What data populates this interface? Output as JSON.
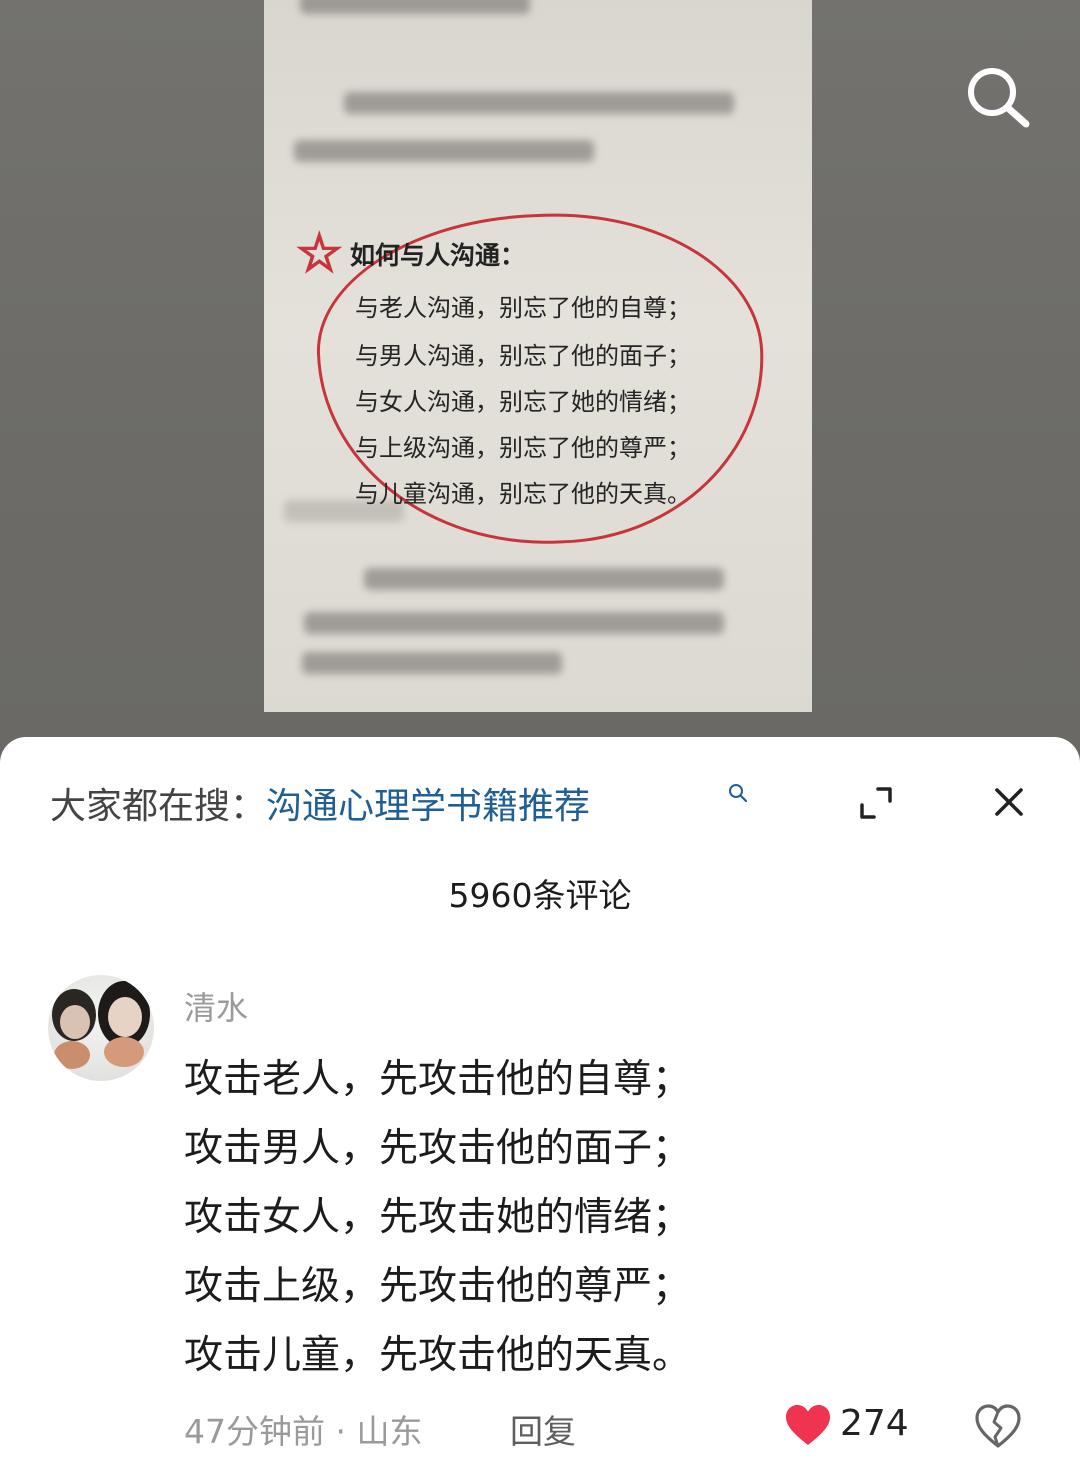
{
  "video": {
    "book": {
      "heading": "如何与人沟通：",
      "lines": [
        "与老人沟通，别忘了他的自尊；",
        "与男人沟通，别忘了他的面子；",
        "与女人沟通，别忘了她的情绪；",
        "与上级沟通，别忘了他的尊严；",
        "与儿童沟通，别忘了他的天真。"
      ]
    },
    "search_icon": "search-icon"
  },
  "sheet": {
    "suggest_prefix": "大家都在搜：",
    "suggest_query": "沟通心理学书籍推荐",
    "comment_count": "5960条评论",
    "icons": {
      "expand": "expand-icon",
      "close": "close-icon"
    }
  },
  "comment": {
    "username": "清水",
    "lines": [
      "攻击老人，先攻击他的自尊；",
      "攻击男人，先攻击他的面子；",
      "攻击女人，先攻击她的情绪；",
      "攻击上级，先攻击他的尊严；",
      "攻击儿童，先攻击他的天真。"
    ],
    "time": "47分钟前",
    "separator": "·",
    "location": "山东",
    "reply_label": "回复",
    "likes": "274",
    "like_color": "#f0334f"
  }
}
